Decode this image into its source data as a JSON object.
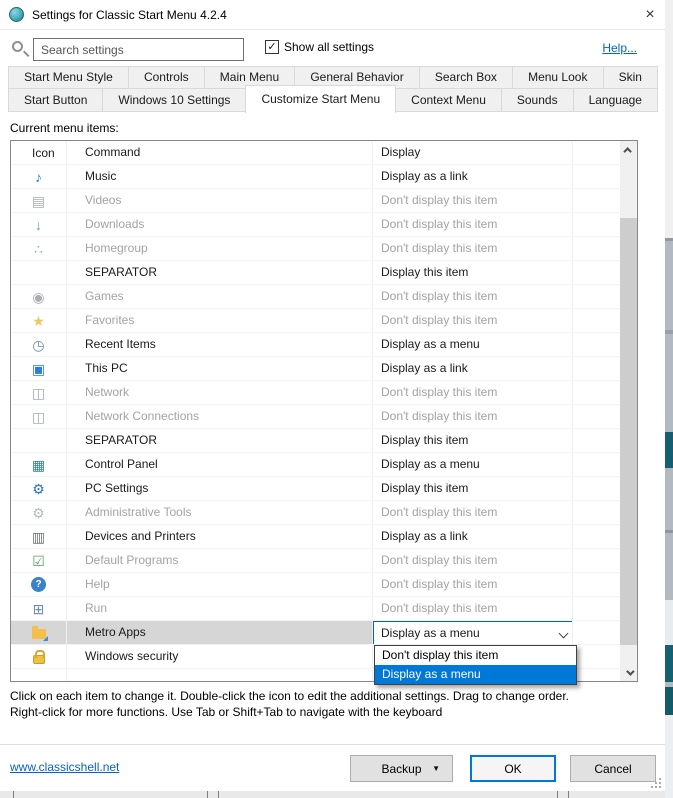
{
  "window": {
    "title": "Settings for Classic Start Menu 4.2.4",
    "close_glyph": "×"
  },
  "toolbar": {
    "search_placeholder": "Search settings",
    "show_all_label": "Show all settings",
    "show_all_checked": true,
    "check_glyph": "✓",
    "help_label": "Help..."
  },
  "tabs": {
    "row1": [
      "Start Menu Style",
      "Controls",
      "Main Menu",
      "General Behavior",
      "Search Box",
      "Menu Look",
      "Skin"
    ],
    "row2": [
      "Start Button",
      "Windows 10 Settings",
      "Customize Start Menu",
      "Context Menu",
      "Sounds",
      "Language"
    ],
    "active": "Customize Start Menu"
  },
  "content": {
    "label": "Current menu items:",
    "columns": {
      "icon": "Icon",
      "command": "Command",
      "display": "Display"
    },
    "rows": [
      {
        "command": "Music",
        "display": "Display as a link",
        "state": "normal",
        "icon": {
          "name": "music-note-icon",
          "glyph": "♪",
          "color": "#2a7fd4"
        }
      },
      {
        "command": "Videos",
        "display": "Don't display this item",
        "state": "disabled",
        "icon": {
          "name": "videos-icon",
          "glyph": "▤",
          "color": "#a9aeb4"
        }
      },
      {
        "command": "Downloads",
        "display": "Don't display this item",
        "state": "disabled",
        "icon": {
          "name": "downloads-icon",
          "glyph": "↓",
          "color": "#5b9bd5"
        }
      },
      {
        "command": "Homegroup",
        "display": "Don't display this item",
        "state": "disabled",
        "icon": {
          "name": "homegroup-icon",
          "glyph": "∴",
          "color": "#79b48a"
        }
      },
      {
        "command": "SEPARATOR",
        "display": "Display this item",
        "state": "normal",
        "icon": null
      },
      {
        "command": "Games",
        "display": "Don't display this item",
        "state": "disabled",
        "icon": {
          "name": "games-icon",
          "glyph": "◉",
          "color": "#a9aeb4"
        }
      },
      {
        "command": "Favorites",
        "display": "Don't display this item",
        "state": "disabled",
        "icon": {
          "name": "favorites-icon",
          "glyph": "★",
          "color": "#eec863"
        }
      },
      {
        "command": "Recent Items",
        "display": "Display as a menu",
        "state": "normal",
        "icon": {
          "name": "recent-items-icon",
          "glyph": "◷",
          "color": "#6a89a3"
        }
      },
      {
        "command": "This PC",
        "display": "Display as a link",
        "state": "normal",
        "icon": {
          "name": "this-pc-icon",
          "glyph": "▣",
          "color": "#2a7fd4"
        }
      },
      {
        "command": "Network",
        "display": "Don't display this item",
        "state": "disabled",
        "icon": {
          "name": "network-icon",
          "glyph": "◫",
          "color": "#a3adb8"
        }
      },
      {
        "command": "Network Connections",
        "display": "Don't display this item",
        "state": "disabled",
        "icon": {
          "name": "network-connections-icon",
          "glyph": "◫",
          "color": "#a3adb8"
        }
      },
      {
        "command": "SEPARATOR",
        "display": "Display this item",
        "state": "normal",
        "icon": null
      },
      {
        "command": "Control Panel",
        "display": "Display as a menu",
        "state": "normal",
        "icon": {
          "name": "control-panel-icon",
          "glyph": "▦",
          "color": "#2a7fd4"
        }
      },
      {
        "command": "PC Settings",
        "display": "Display this item",
        "state": "normal",
        "icon": {
          "name": "pc-settings-icon",
          "glyph": "⚙",
          "color": "#2a6fd0"
        }
      },
      {
        "command": "Administrative Tools",
        "display": "Don't display this item",
        "state": "disabled",
        "icon": {
          "name": "admin-tools-icon",
          "glyph": "⚙",
          "color": "#b4bac0"
        }
      },
      {
        "command": "Devices and Printers",
        "display": "Display as a link",
        "state": "normal",
        "icon": {
          "name": "devices-printers-icon",
          "glyph": "▥",
          "color": "#6f7377"
        }
      },
      {
        "command": "Default Programs",
        "display": "Don't display this item",
        "state": "disabled",
        "icon": {
          "name": "default-programs-icon",
          "glyph": "☑",
          "color": "#57a05a"
        }
      },
      {
        "command": "Help",
        "display": "Don't display this item",
        "state": "disabled",
        "icon": {
          "name": "help-icon",
          "glyph": "?",
          "css": "g-help"
        }
      },
      {
        "command": "Run",
        "display": "Don't display this item",
        "state": "disabled",
        "icon": {
          "name": "run-icon",
          "glyph": "⊞",
          "color": "#6c8db0"
        }
      },
      {
        "command": "Metro Apps",
        "display": "",
        "state": "normal",
        "selected": true,
        "combobox": true,
        "icon": {
          "name": "metro-apps-icon",
          "css": "g-folder"
        }
      },
      {
        "command": "Windows security",
        "display": "",
        "state": "normal",
        "icon": {
          "name": "windows-security-icon",
          "css": "g-lock"
        }
      }
    ],
    "combobox": {
      "value": "Display as a menu"
    },
    "dropdown": {
      "items": [
        {
          "label": "Don't display this item",
          "selected": false
        },
        {
          "label": "Display as a menu",
          "selected": true
        }
      ]
    }
  },
  "footer": {
    "help_line1": "Click on each item to change it. Double-click the icon to edit the additional settings. Drag to change order.",
    "help_line2": "Right-click for more functions. Use Tab or Shift+Tab to navigate with the keyboard",
    "link": "www.classicshell.net",
    "backup_label": "Backup",
    "backup_arrow": "▼",
    "ok_label": "OK",
    "cancel_label": "Cancel"
  },
  "colors": {
    "accent": "#0078d7",
    "combobox_border": "#0067b8",
    "selection_gray": "#d6d6d6",
    "disabled_text": "#a3a3a3",
    "link": "#0563c1"
  }
}
